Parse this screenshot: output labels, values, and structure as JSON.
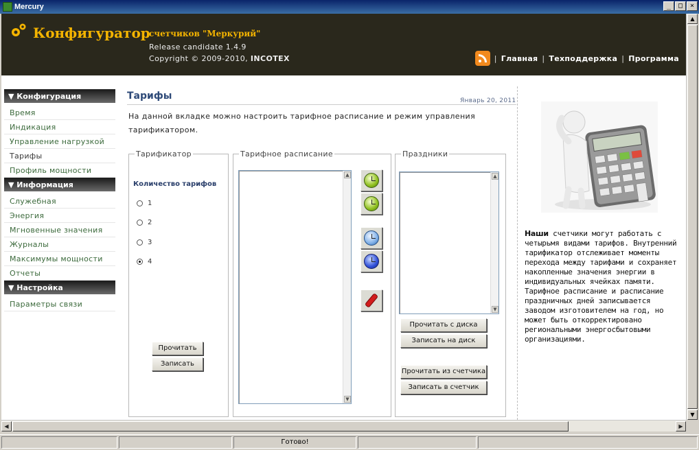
{
  "window": {
    "title": "Mercury"
  },
  "window_buttons": {
    "minimize": "_",
    "maximize": "□",
    "close": "×"
  },
  "header": {
    "brand": "Конфигуратор",
    "brand_sub": "счетчиков \"Меркурий\"",
    "release": "Release candidate 1.4.9",
    "copyright_prefix": "Copyright © 2009-2010, ",
    "copyright_company": "INCOTEX",
    "nav": [
      "Главная",
      "Техподдержка",
      "Программа"
    ],
    "separator": "|"
  },
  "sidebar": {
    "sections": [
      {
        "title": "▼ Конфигурация",
        "items": [
          "Время",
          "Индикация",
          "Управление нагрузкой",
          "Тарифы",
          "Профиль мощности"
        ]
      },
      {
        "title": "▼ Информация",
        "items": [
          "Служебная",
          "Энергия",
          "Мгновенные значения",
          "Журналы",
          "Максимумы мощности",
          "Отчеты"
        ]
      },
      {
        "title": "▼ Настройка",
        "items": [
          "Параметры связи"
        ]
      }
    ],
    "active_item": "Тарифы"
  },
  "main": {
    "title": "Тарифы",
    "date": "Январь 20, 2011",
    "intro": "На данной вкладке можно настроить тарифное расписание и режим управления тарификатором.",
    "tarificator": {
      "legend": "Тарификатор",
      "count_label": "Количество тарифов",
      "options": [
        "1",
        "2",
        "3",
        "4"
      ],
      "selected": "4",
      "read_button": "Прочитать",
      "write_button": "Записать"
    },
    "schedule": {
      "legend": "Тарифное расписание"
    },
    "holidays": {
      "legend": "Праздники",
      "read_disk": "Прочитать с диска",
      "write_disk": "Записать на диск",
      "read_meter": "Прочитать из счетчика",
      "write_meter": "Записать в счетчик"
    }
  },
  "aside": {
    "text_bold": "Наши",
    "text": " счетчики могут работать с четырьмя видами тарифов. Внутренний тарификатор отслеживает моменты перехода между тарифами и сохраняет накопленные значения энергии в индивидуальных ячейках памяти. Тарифное расписание и расписание праздничных дней записывается заводом изготовителем на год, но может быть откорректировано региональными энергосбытовыми организациями."
  },
  "status": {
    "text": "Готово!"
  }
}
